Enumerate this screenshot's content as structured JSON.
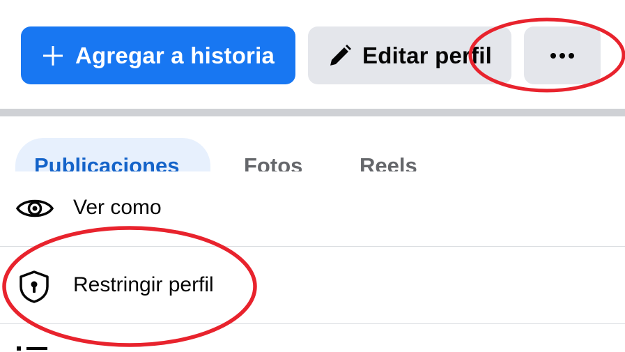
{
  "actions": {
    "add_story_label": "Agregar a historia",
    "edit_profile_label": "Editar perfil",
    "more_label": "•••"
  },
  "tabs": [
    {
      "label": "Publicaciones",
      "active": true
    },
    {
      "label": "Fotos",
      "active": false
    },
    {
      "label": "Reels",
      "active": false
    }
  ],
  "menu": {
    "items": [
      {
        "label": "Ver como",
        "icon": "eye-icon"
      },
      {
        "label": "Restringir perfil",
        "icon": "shield-lock-icon"
      },
      {
        "label": "",
        "icon": "list-icon"
      }
    ]
  },
  "colors": {
    "primary": "#1877f2",
    "secondary_button": "#e4e6eb",
    "active_tab_text": "#1463c9",
    "active_tab_bg": "#e7f0fd",
    "annotation": "#e8232d"
  }
}
